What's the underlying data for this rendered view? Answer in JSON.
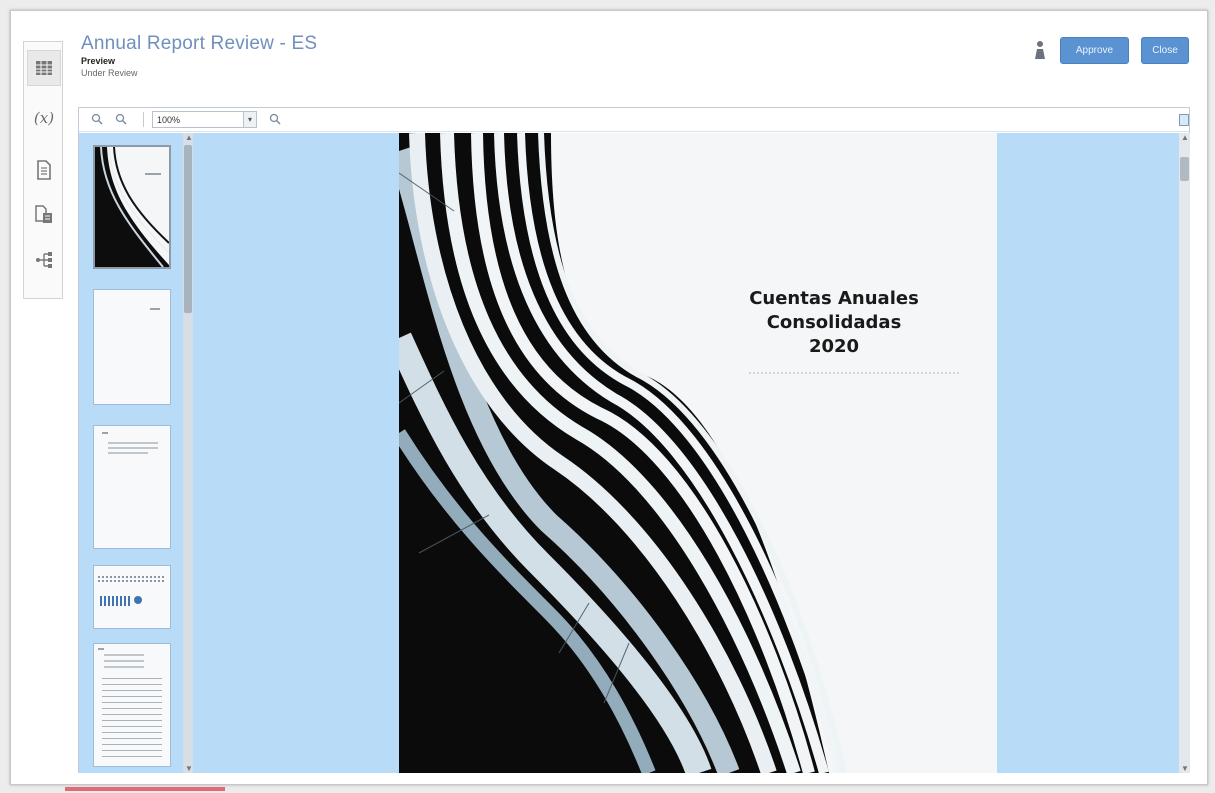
{
  "header": {
    "title": "Annual Report Review - ES",
    "subtitle": "Preview",
    "status": "Under Review",
    "primary_button": "Approve",
    "secondary_button": "Close"
  },
  "left_toolbar": {
    "items": [
      {
        "icon": "grid-table-icon"
      },
      {
        "icon": "variable-x-icon",
        "label": "(x)"
      },
      {
        "icon": "document-icon"
      },
      {
        "icon": "document-stack-icon"
      },
      {
        "icon": "tree-branch-icon"
      }
    ]
  },
  "viewer_toolbar": {
    "zoom_value": "100%",
    "icons": [
      "zoom-out-icon",
      "zoom-in-icon",
      "search-icon"
    ]
  },
  "thumbnails": [
    {
      "page": 1,
      "selected": true
    },
    {
      "page": 2,
      "selected": false
    },
    {
      "page": 3,
      "selected": false
    },
    {
      "page": 4,
      "selected": false
    },
    {
      "page": 5,
      "selected": false
    }
  ],
  "document": {
    "cover_title_line1": "Cuentas Anuales",
    "cover_title_line2": "Consolidadas",
    "cover_title_line3": "2020"
  },
  "colors": {
    "accent": "#5b93d2",
    "title": "#6f8fbd",
    "viewer_bg": "#b8dbf7"
  }
}
